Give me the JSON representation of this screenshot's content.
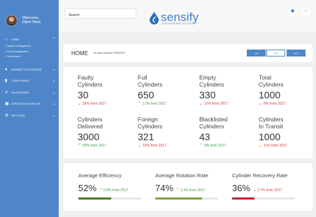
{
  "user": {
    "greeting": "Welcome,",
    "name": "Dijon Stols"
  },
  "nav": {
    "home": "HOME",
    "sub": [
      "Cylinder Management",
      "Event Management",
      "Performance"
    ],
    "groups": [
      "MANAGE CUSTOMERS",
      "COMPLIANCE",
      "VALIDATIONS",
      "CONDITION MONITOR",
      "SETTINGS"
    ]
  },
  "header": {
    "search_value": "Search",
    "brand": "sensify",
    "tagline": "GATEKEEPER SYSTEM™"
  },
  "homebar": {
    "title": "HOME",
    "note": "All data updated 23/08/2019",
    "ranges": [
      "QR",
      "YTD",
      "MTD"
    ]
  },
  "stats": [
    {
      "label": "Faulty\nCylinders",
      "value": "30",
      "change": "28% from 2017",
      "dir": "down"
    },
    {
      "label": "Full\nCylinders",
      "value": "650",
      "change": "17% from 2017",
      "dir": "up"
    },
    {
      "label": "Empty\nCylinders",
      "value": "330",
      "change": "12% from 2017",
      "dir": "down"
    },
    {
      "label": "Total\nCylinders",
      "value": "1000",
      "change": "8% from 2017",
      "dir": "down"
    },
    {
      "label": "Cylinders\nDelivered",
      "value": "3000",
      "change": "50% from 2017",
      "dir": "up"
    },
    {
      "label": "Foreign\nCylinders",
      "value": "321",
      "change": "19% from 2017",
      "dir": "down"
    },
    {
      "label": "Blacklisted\nCylinders",
      "value": "43",
      "change": "9% from 2017",
      "dir": "up"
    },
    {
      "label": "Cylinders\nIn Transit",
      "value": "1000",
      "change": "11% from 2017",
      "dir": "down"
    }
  ],
  "averages": [
    {
      "label": "Average Efficiency",
      "value": "52%",
      "change": "0.8% from 2017",
      "dir": "up",
      "level": 0.52,
      "color": "#4a7d1e"
    },
    {
      "label": "Average Rotation Rate",
      "value": "74%",
      "change": "1.3% from 2017",
      "dir": "up",
      "level": 0.74,
      "color": "#7fa334"
    },
    {
      "label": "Cylinder Recovery Rate",
      "value": "36%",
      "change": "2.7% from 2017",
      "dir": "down",
      "level": 0.36,
      "color": "#c0242a"
    }
  ],
  "colors": {
    "sidebar": "#4f86c9",
    "brand": "#3f7dc4",
    "up": "#3a9a4a",
    "down": "#d23a3a"
  }
}
